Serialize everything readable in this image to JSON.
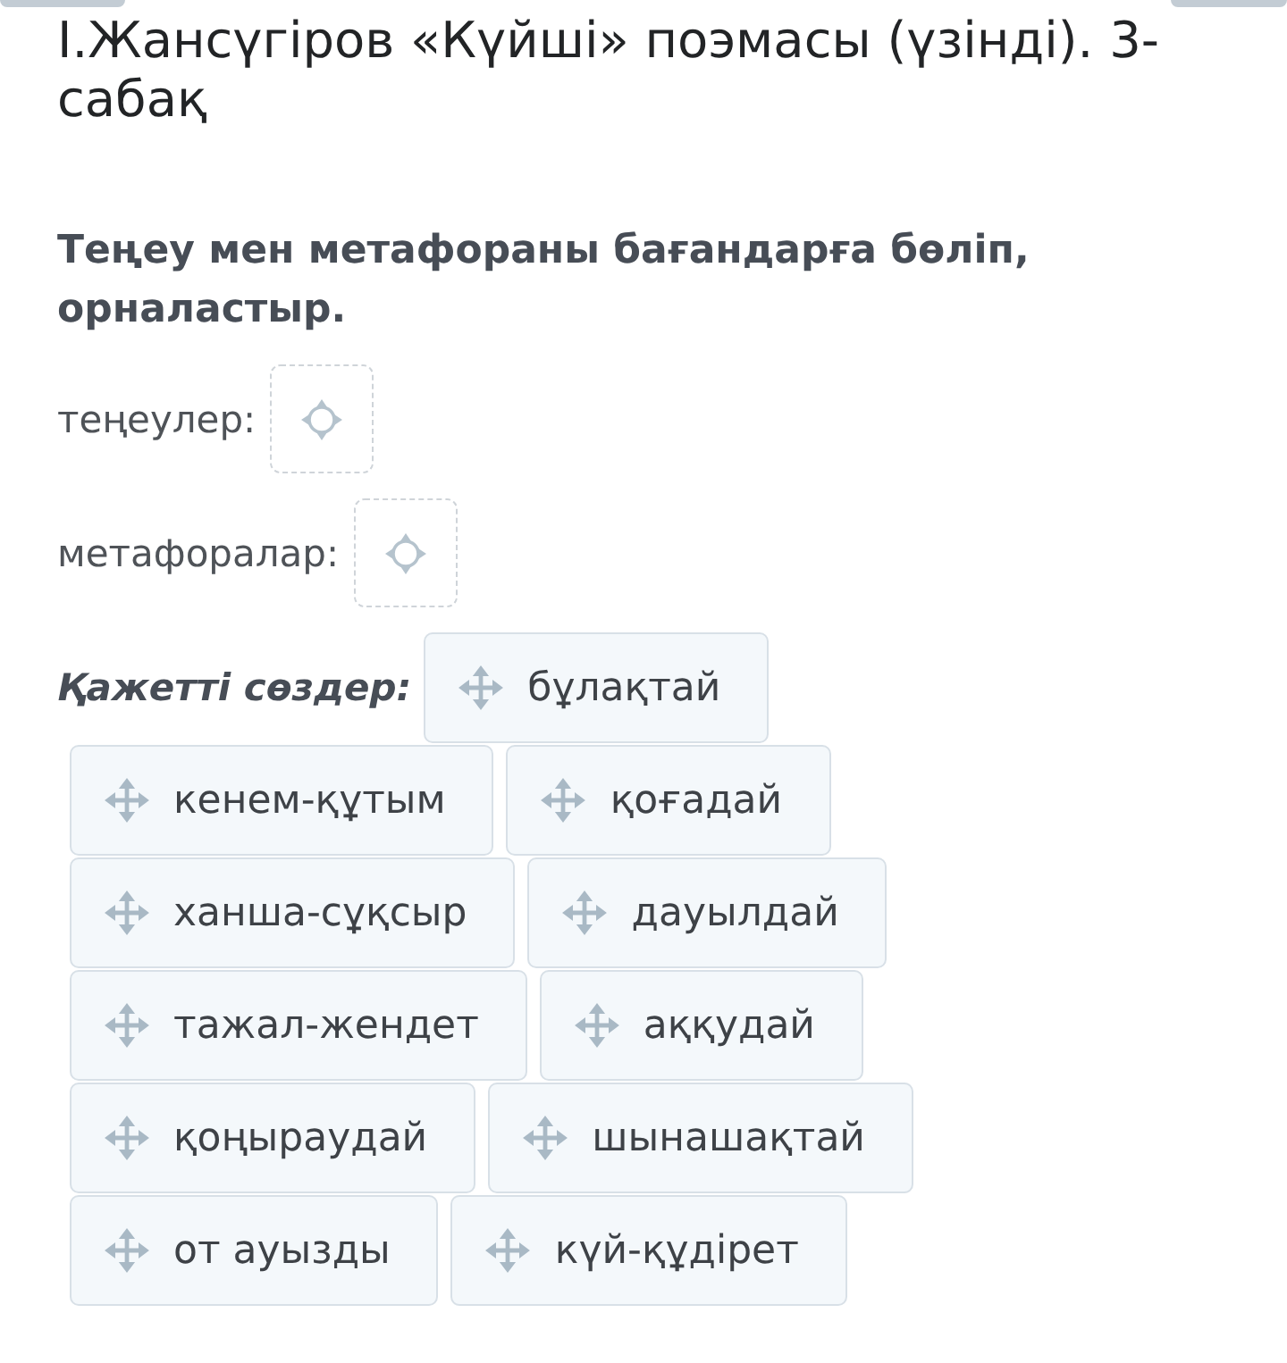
{
  "title": "І.Жансүгіров «Күйші» поэмасы (үзінді). 3-сабақ",
  "instruction": "Теңеу мен метафораны бағандарға бөліп, орналастыр.",
  "drop_zones": [
    {
      "label": "теңеулер:"
    },
    {
      "label": "метафоралар:"
    }
  ],
  "word_bank": {
    "label": "Қажетті сөздер:",
    "words": [
      "бұлақтай",
      "кенем-құтым",
      "қоғадай",
      "ханша-сұқсыр",
      "дауылдай",
      "тажал-жендет",
      "аққудай",
      "қоңыраудай",
      "шынашақтай",
      "от ауызды",
      "күй-құдірет"
    ]
  }
}
